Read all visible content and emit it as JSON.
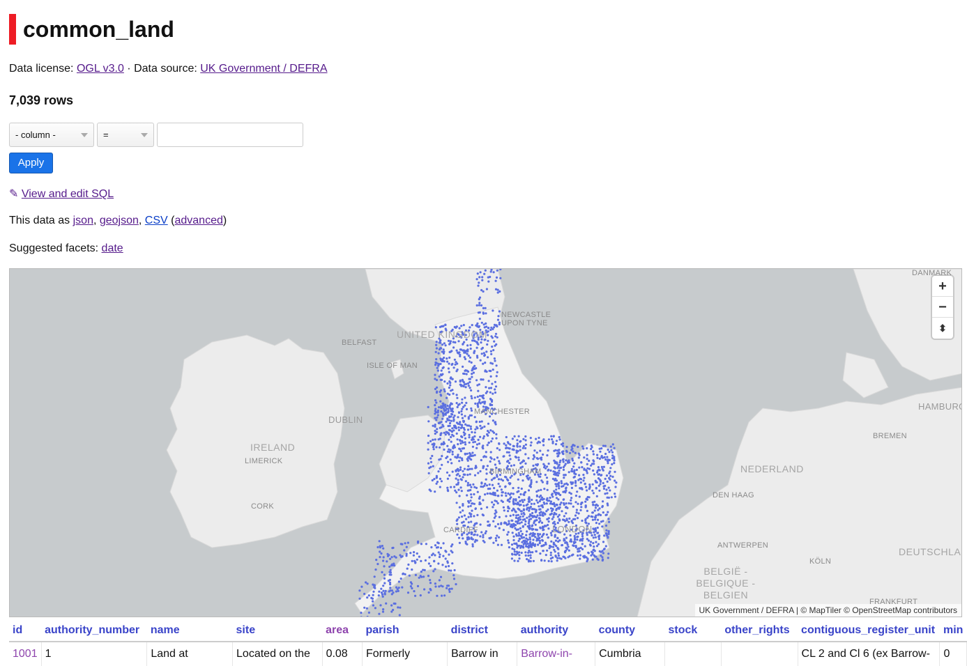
{
  "page": {
    "title": "common_land",
    "license_label": "Data license:",
    "license_link": "OGL v3.0",
    "source_sep": "· Data source:",
    "source_link": "UK Government / DEFRA",
    "row_count": "7,039 rows"
  },
  "filter": {
    "column_select": "- column -",
    "op_select": "=",
    "value": "",
    "apply_label": "Apply"
  },
  "links": {
    "edit_sql_icon": "✎",
    "edit_sql": "View and edit SQL",
    "data_as_prefix": "This data as",
    "json": "json",
    "geojson": "geojson",
    "csv": "CSV",
    "advanced": "advanced",
    "facets_prefix": "Suggested facets:",
    "facet_date": "date"
  },
  "map": {
    "zoom_in": "+",
    "zoom_out": "−",
    "reset_north": "⬍",
    "attribution": "UK Government / DEFRA | © MapTiler © OpenStreetMap contributors",
    "marker_color": "#5b6fe0",
    "labels": {
      "denmark": "DANMARK",
      "newcastle": "NEWCASTLE UPON TYNE",
      "uk": "UNITED KINGDOM",
      "belfast": "BELFAST",
      "isle_of_man": "ISLE OF MAN",
      "dublin": "DUBLIN",
      "manchester": "MANCHESTER",
      "ireland": "IRELAND",
      "limerick": "LIMERICK",
      "birmingham": "BIRMINGHAM",
      "cork": "CORK",
      "cardiff": "CARDIFF",
      "london": "LONDON",
      "hamburg": "HAMBURG",
      "bremen": "BREMEN",
      "nederland": "NEDERLAND",
      "den_haag": "DEN HAAG",
      "antwerpen": "ANTWERPEN",
      "belgique": "BELGIË - BELGIQUE - BELGIEN",
      "koln": "KÖLN",
      "deutschland": "DEUTSCHLAND",
      "frankfurt": "FRANKFURT"
    }
  },
  "table": {
    "columns": [
      "id",
      "authority_number",
      "name",
      "site",
      "area",
      "parish",
      "district",
      "authority",
      "county",
      "stock",
      "other_rights",
      "contiguous_register_unit",
      "min"
    ],
    "row": [
      "1001",
      "1",
      "Land at",
      "Located on the",
      "0.08",
      "Formerly",
      "Barrow in",
      "Barrow-in-",
      "Cumbria",
      "",
      "",
      "CL 2 and Cl 6 (ex Barrow-",
      "0"
    ]
  }
}
